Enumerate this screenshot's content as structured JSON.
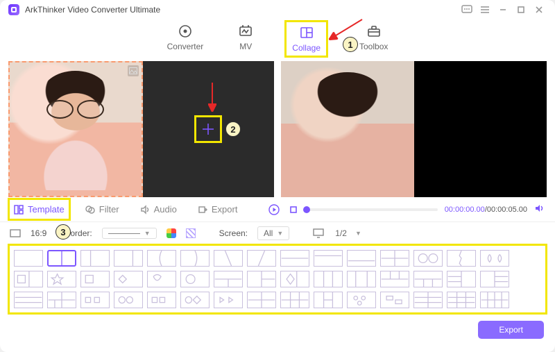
{
  "app": {
    "title": "ArkThinker Video Converter Ultimate"
  },
  "nav": {
    "converter": "Converter",
    "mv": "MV",
    "collage": "Collage",
    "toolbox": "Toolbox"
  },
  "tabs": {
    "template": "Template",
    "filter": "Filter",
    "audio": "Audio",
    "export": "Export"
  },
  "playback": {
    "current": "00:00:00.00",
    "duration": "00:00:05.00",
    "sep": "/"
  },
  "options": {
    "ratio": "16:9",
    "border_label": "Border:",
    "screen_label": "Screen:",
    "screen_value": "All",
    "split_value": "1/2"
  },
  "footer": {
    "export": "Export"
  },
  "annotations": {
    "n1": "1",
    "n2": "2",
    "n3": "3"
  }
}
